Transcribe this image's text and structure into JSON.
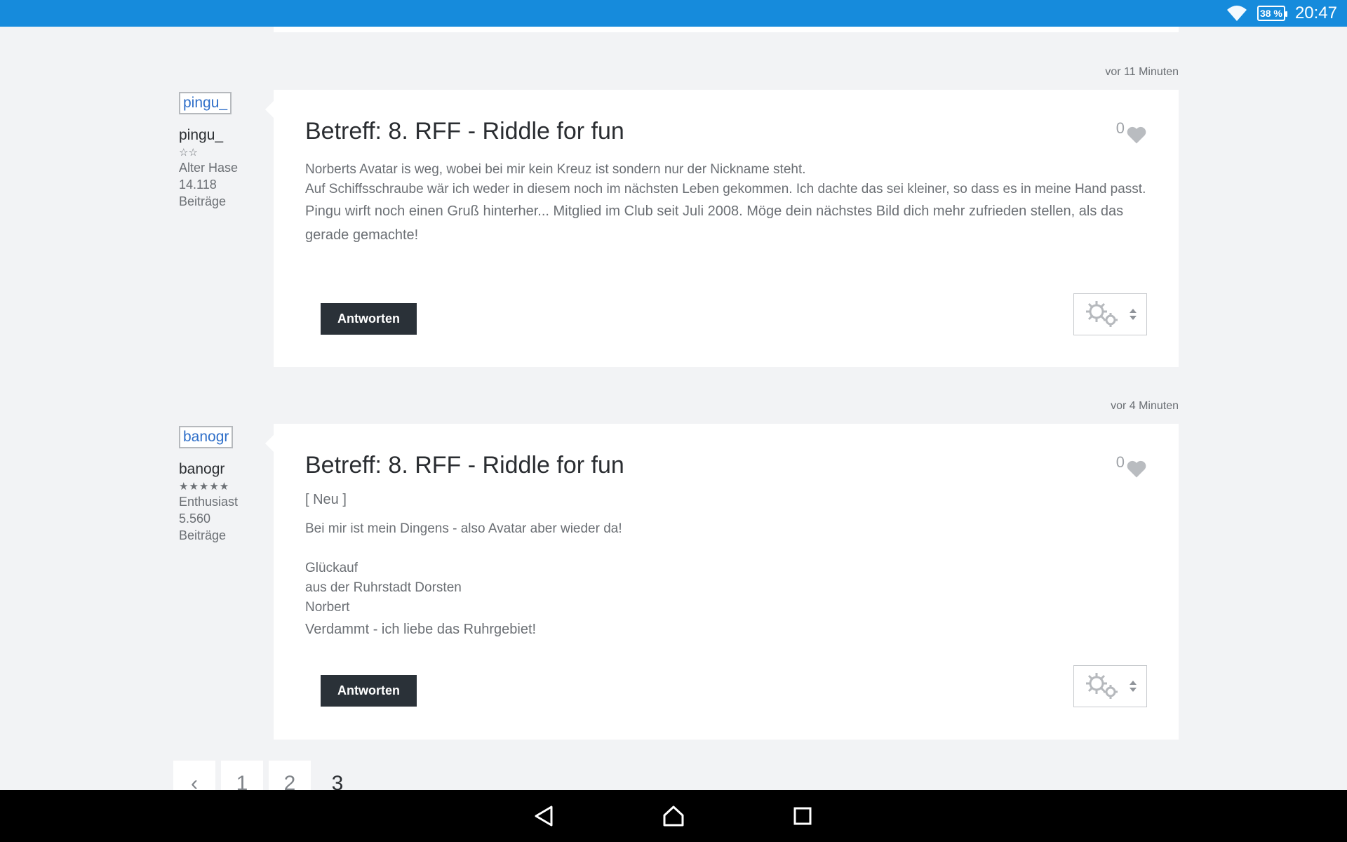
{
  "status_bar": {
    "battery": "38 %",
    "time": "20:47"
  },
  "posts": [
    {
      "time": "vor 11 Minuten",
      "avatar_alt": "pingu_",
      "author": "pingu_",
      "rank_stars": "☆☆",
      "rank": "Alter Hase",
      "post_count": "14.118",
      "posts_label": "Beiträge",
      "title": "Betreff: 8. RFF - Riddle for fun",
      "likes": "0",
      "body_lines": [
        "Norberts Avatar is weg, wobei bei mir kein Kreuz ist sondern nur der Nickname steht.",
        "Auf Schiffsschraube wär ich weder in diesem noch im nächsten Leben gekommen. Ich dachte das sei kleiner, so dass es in meine Hand passt."
      ],
      "signature": "Pingu wirft noch einen Gruß hinterher... Mitglied im Club seit Juli 2008. Möge dein nächstes Bild dich mehr zufrieden stellen, als das gerade gemachte!",
      "reply_label": "Antworten"
    },
    {
      "time": "vor 4 Minuten",
      "avatar_alt": "banogr",
      "author": "banogr",
      "rank_stars": "★★★★★",
      "rank": "Enthusiast",
      "post_count": "5.560",
      "posts_label": "Beiträge",
      "title": "Betreff: 8. RFF - Riddle for fun",
      "tag": "[ Neu ]",
      "likes": "0",
      "body_lines": [
        "Bei mir ist mein Dingens - also Avatar aber wieder da!",
        "",
        "Glückauf",
        "aus der Ruhrstadt Dorsten",
        "Norbert"
      ],
      "signature": "Verdammt - ich liebe das Ruhrgebiet!",
      "reply_label": "Antworten"
    }
  ],
  "pagination": {
    "prev": "‹",
    "pages": [
      "1",
      "2",
      "3"
    ],
    "current": "3"
  },
  "nav_icons": [
    "back-icon",
    "home-icon",
    "recents-icon"
  ]
}
